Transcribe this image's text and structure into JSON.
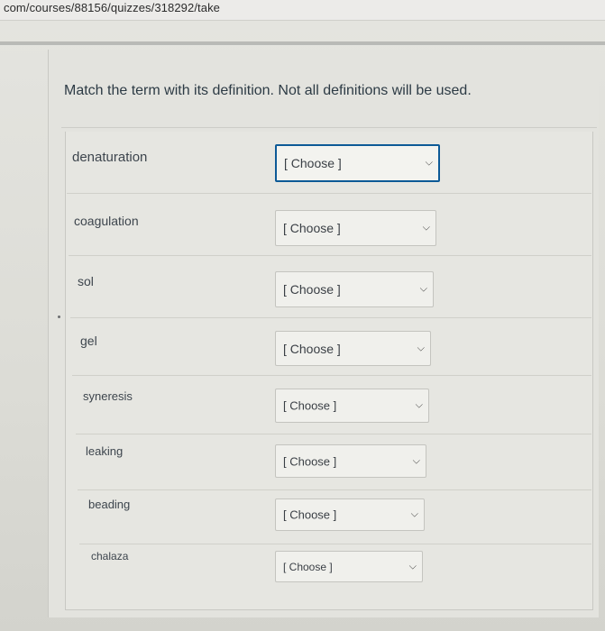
{
  "browser": {
    "url": "com/courses/88156/quizzes/318292/take"
  },
  "question": {
    "text": "Match the term with its definition. Not all definitions will be used."
  },
  "matches": [
    {
      "term": "denaturation",
      "selected": "[ Choose ]"
    },
    {
      "term": "coagulation",
      "selected": "[ Choose ]"
    },
    {
      "term": "sol",
      "selected": "[ Choose ]"
    },
    {
      "term": "gel",
      "selected": "[ Choose ]"
    },
    {
      "term": "syneresis",
      "selected": "[ Choose ]"
    },
    {
      "term": "leaking",
      "selected": "[ Choose ]"
    },
    {
      "term": "beading",
      "selected": "[ Choose ]"
    },
    {
      "term": "chalaza",
      "selected": "[ Choose ]"
    }
  ],
  "icons": {
    "dropdown": "chevron-down-icon"
  },
  "colors": {
    "focus_border": "#0d5a96",
    "text": "#2d3b45"
  }
}
